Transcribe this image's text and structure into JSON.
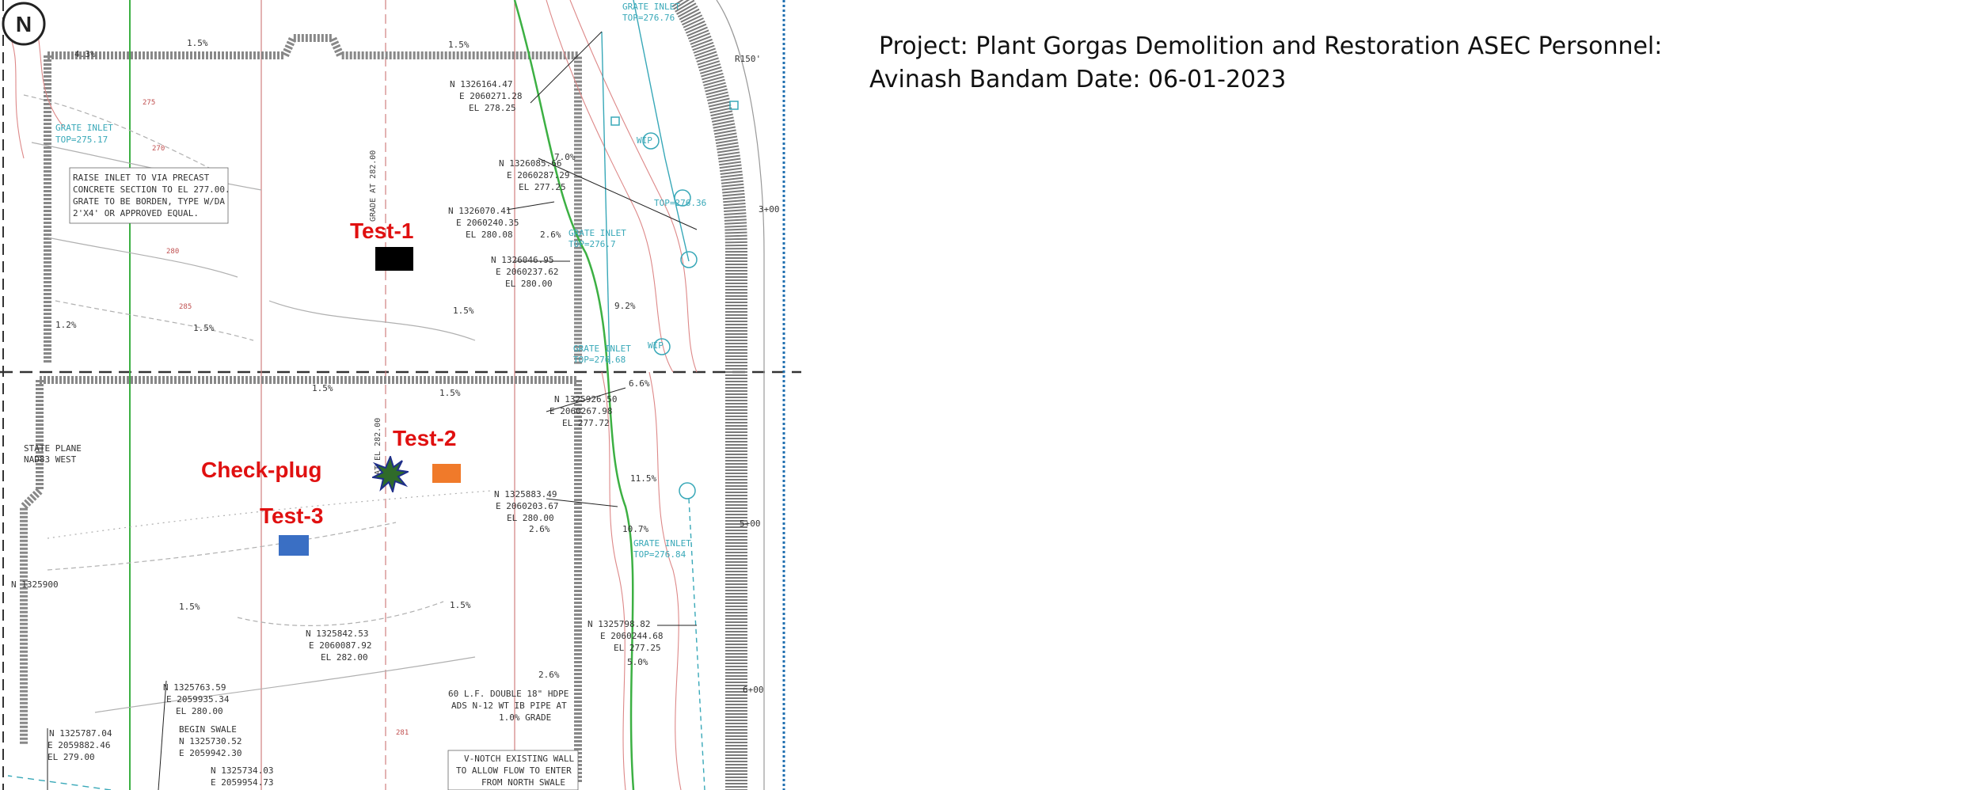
{
  "header": {
    "project_label": "Project:",
    "project_name": "Plant Gorgas Demolition and Restoration",
    "personnel_label": "ASEC Personnel:",
    "personnel_name": "Avinash Bandam",
    "date_label": "Date:",
    "date_value": "06-01-2023"
  },
  "test_points": [
    {
      "label": "Test-1",
      "color": "#000000"
    },
    {
      "label": "Test-2",
      "color": "#f07a2a"
    },
    {
      "label": "Test-3",
      "color": "#3a6fc4"
    },
    {
      "label": "Check-plug",
      "color": "#2f6b2a"
    }
  ],
  "north_arrow": {
    "letter": "N",
    "caption_line1": "STATE PLANE",
    "caption_line2": "NAD83 WEST"
  },
  "plan_labels": {
    "grate_inlet_1": "GRATE INLET",
    "grate_inlet_1_top": "TOP=275.17",
    "raise_inlet_1": "RAISE INLET TO VIA PRECAST",
    "raise_inlet_2": "CONCRETE SECTION TO EL 277.00.",
    "raise_inlet_3": "GRATE TO BE BORDEN, TYPE W/DA",
    "raise_inlet_4": "2'X4' OR APPROVED EQUAL.",
    "pt1_n": "N 1326164.47",
    "pt1_e": "E 2060271.28",
    "pt1_el": "EL 278.25",
    "pt2_n": "N 1326085.66",
    "pt2_e": "E 2060287.29",
    "pt2_el": "EL 277.25",
    "pt3_n": "N 1326070.41",
    "pt3_e": "E 2060240.35",
    "pt3_el": "EL 280.08",
    "pt4_n": "N 1326046.95",
    "pt4_e": "E 2060237.62",
    "pt4_el": "EL 280.00",
    "pt5_n": "N 1325926.50",
    "pt5_e": "E 2060267.98",
    "pt5_el": "EL 277.72",
    "pt6_n": "N 1325883.49",
    "pt6_e": "E 2060203.67",
    "pt6_el": "EL 280.00",
    "pt7_n": "N 1325842.53",
    "pt7_e": "E 2060087.92",
    "pt7_el": "EL 282.00",
    "pt8_n": "N 1325798.82",
    "pt8_e": "E 2060244.68",
    "pt8_el": "EL 277.25",
    "pt9_n": "N 1325763.59",
    "pt9_e": "E 2059935.34",
    "pt9_el": "EL 280.00",
    "pt10_n": "N 1325787.04",
    "pt10_e": "E 2059882.46",
    "pt10_el": "EL 279.00",
    "pt11_n": "N 1325730.52",
    "pt11_e": "E 2059942.30",
    "pt12_n": "N 1325734.03",
    "pt12_e": "E 2059954.73",
    "begin_swale": "BEGIN SWALE",
    "north_grid": "N 1325900",
    "pipe_1": "60 L.F. DOUBLE 18\" HDPE",
    "pipe_2": "ADS N-12 WT IB PIPE AT",
    "pipe_3": "1.0% GRADE",
    "vnotch_1": "V-NOTCH EXISTING WALL",
    "vnotch_2": "TO ALLOW FLOW TO ENTER",
    "vnotch_3": "FROM NORTH SWALE",
    "grade_at_282_a": "GRADE AT 282.00",
    "grade_at_282_b": "AT EL 282.00",
    "slope_1_5": "1.5%",
    "slope_4_3": "4.3%",
    "slope_2_6": "2.6%",
    "slope_1_2": "1.2%",
    "slope_7_0": "7.0%",
    "slope_6_6": "6.6%",
    "slope_11_5": "11.5%",
    "slope_10_7": "10.7%",
    "slope_5_0": "5.0%",
    "slope_9_2": "9.2%",
    "grate_inlet_top_27676": "TOP=276.76",
    "grate_inlet_top_27668": "TOP=276.68",
    "grate_inlet_top_27684": "TOP=276.84",
    "grate_inlet_top_27636": "TOP=276.36",
    "grate_inlet_top_2767": "TOP=276.7",
    "r150": "R150'",
    "sta_300": "3+00",
    "sta_500": "5+00",
    "sta_600": "6+00",
    "wip": "WIP",
    "contour_270": "270",
    "contour_275": "275",
    "contour_280": "280",
    "contour_285": "285",
    "contour_281": "281"
  }
}
